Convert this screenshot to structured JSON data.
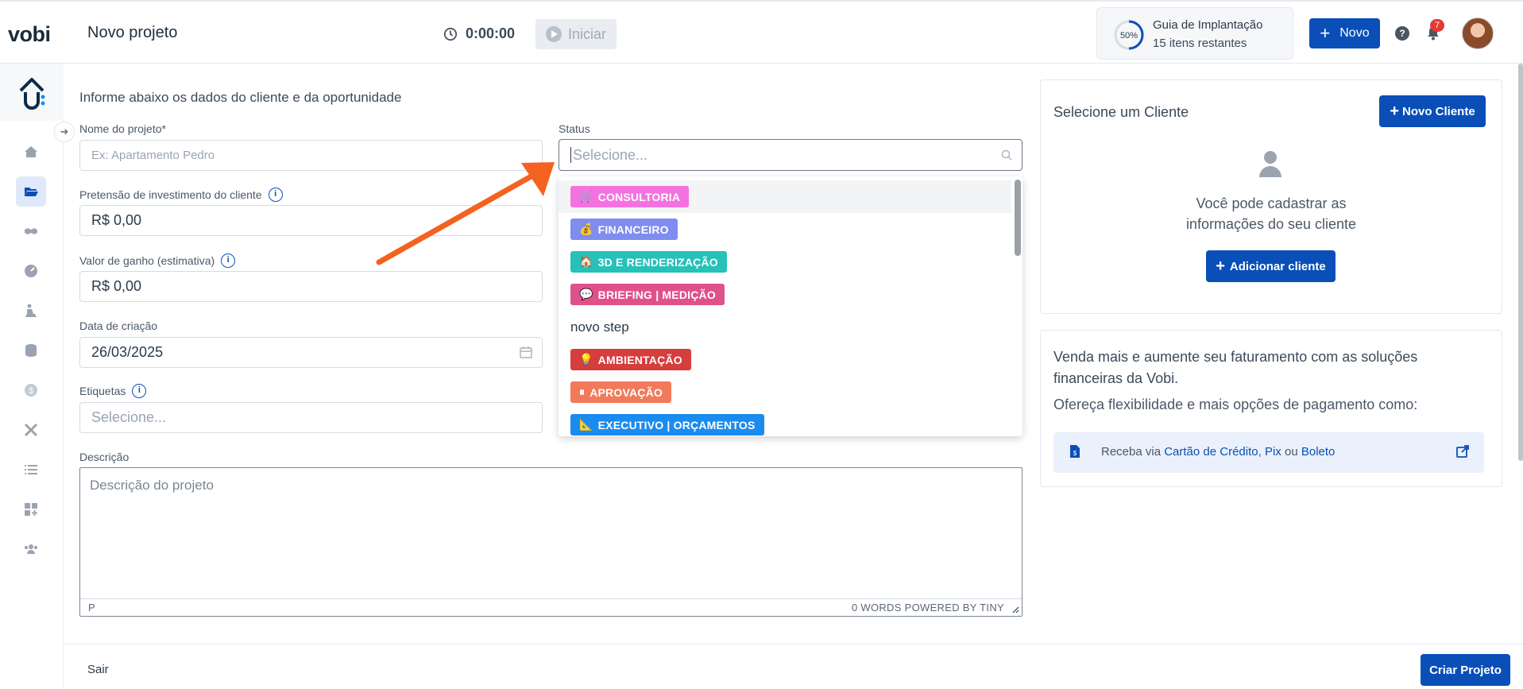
{
  "brand": {
    "logo_text": "vobi"
  },
  "header": {
    "title": "Novo projeto",
    "timer": "0:00:00",
    "start_label": "Iniciar",
    "guide": {
      "percent": "50%",
      "progress": 0.5,
      "title": "Guia de Implantação",
      "subtitle": "15 itens restantes"
    },
    "new_label": "Novo",
    "help_glyph": "?",
    "notifications_count": "7"
  },
  "sidebar": {
    "items": [
      {
        "icon": "home-icon"
      },
      {
        "icon": "folder-icon",
        "active": true
      },
      {
        "icon": "handshake-icon"
      },
      {
        "icon": "gauge-icon"
      },
      {
        "icon": "worker-icon"
      },
      {
        "icon": "coins-stack-icon"
      },
      {
        "icon": "dollar-icon"
      },
      {
        "icon": "tools-icon"
      },
      {
        "icon": "list-icon"
      },
      {
        "icon": "apps-add-icon"
      },
      {
        "icon": "team-icon"
      }
    ]
  },
  "form": {
    "section_title": "Informe abaixo os dados do cliente e da oportunidade",
    "project_name": {
      "label": "Nome do projeto*",
      "placeholder": "Ex: Apartamento Pedro"
    },
    "investment": {
      "label": "Pretensão de investimento do cliente",
      "value": "R$ 0,00"
    },
    "gain": {
      "label": "Valor de ganho (estimativa)",
      "value": "R$ 0,00"
    },
    "created": {
      "label": "Data de criação",
      "value": "26/03/2025"
    },
    "tags": {
      "label": "Etiquetas",
      "placeholder": "Selecione..."
    },
    "status": {
      "label": "Status",
      "placeholder": "Selecione..."
    },
    "description": {
      "label": "Descrição",
      "placeholder": "Descrição do projeto",
      "path": "P",
      "words": "0 WORDS  POWERED BY TINY"
    }
  },
  "status_options": [
    {
      "emoji": "🛒",
      "label": "CONSULTORIA",
      "color": "#f472e0",
      "type": "tag"
    },
    {
      "emoji": "💰",
      "label": "FINANCEIRO",
      "color": "#7f8df0",
      "type": "tag"
    },
    {
      "emoji": "🏠",
      "label": "3D E RENDERIZAÇÃO",
      "color": "#26c1b9",
      "type": "tag"
    },
    {
      "emoji": "💬",
      "label": "BRIEFING | MEDIÇÃO",
      "color": "#e0508a",
      "type": "tag"
    },
    {
      "emoji": "",
      "label": "novo step",
      "color": "",
      "type": "plain"
    },
    {
      "emoji": "💡",
      "label": "AMBIENTAÇÃO",
      "color": "#d63d3d",
      "type": "tag"
    },
    {
      "emoji": "⏸",
      "label": "APROVAÇÃO",
      "color": "#f27a5a",
      "type": "tag"
    },
    {
      "emoji": "📐",
      "label": "EXECUTIVO | ORÇAMENTOS",
      "color": "#1a8cf0",
      "type": "tag"
    }
  ],
  "client_panel": {
    "title": "Selecione um Cliente",
    "new_client_label": "Novo Cliente",
    "empty_line1": "Você pode cadastrar as",
    "empty_line2": "informações do seu cliente",
    "add_client_label": "Adicionar cliente"
  },
  "promo_panel": {
    "title": "Venda mais e aumente seu faturamento com as soluções financeiras da Vobi.",
    "subtitle": "Ofereça flexibilidade e mais opções de pagamento como:",
    "receive_prefix": "Receba via ",
    "card": "Cartão de Crédito",
    "sep1": ", ",
    "pix": "Pix",
    "sep2": " ou ",
    "boleto": "Boleto"
  },
  "footer": {
    "exit_label": "Sair",
    "create_label": "Criar Projeto"
  },
  "colors": {
    "primary": "#0a4fb8",
    "arrow": "#f4621f",
    "badge": "#e53935"
  }
}
